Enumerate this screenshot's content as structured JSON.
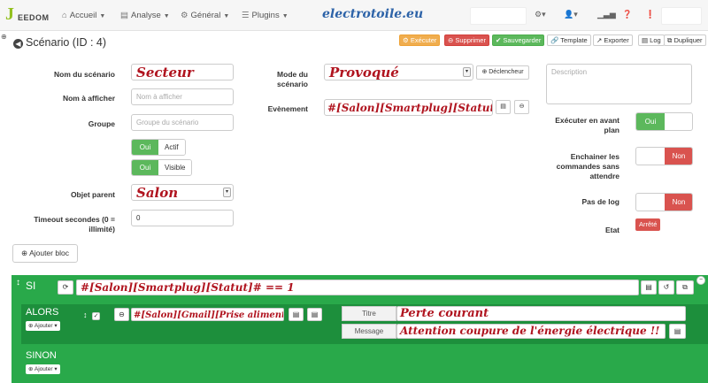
{
  "navbar": {
    "logo_text": "EEDOM",
    "menu": [
      "Accueil",
      "Analyse",
      "Général",
      "Plugins"
    ],
    "watermark": "electrotoile.eu"
  },
  "header": {
    "title": "Scénario (ID : 4)",
    "buttons": {
      "execute": "Exécuter",
      "delete": "Supprimer",
      "save": "Sauvegarder",
      "template": "Template",
      "export": "Exporter",
      "log": "Log",
      "duplicate": "Dupliquer"
    }
  },
  "form": {
    "name_label": "Nom du scénario",
    "name_value": "Secteur",
    "display_label": "Nom à afficher",
    "display_placeholder": "Nom à afficher",
    "group_label": "Groupe",
    "group_placeholder": "Groupe du scénario",
    "active_on": "Oui",
    "active_label": "Actif",
    "visible_on": "Oui",
    "visible_label": "Visible",
    "parent_label": "Objet parent",
    "parent_value": "Salon",
    "timeout_label": "Timeout secondes (0 = illimité)",
    "timeout_value": "0",
    "mode_label": "Mode du scénario",
    "mode_value": "Provoqué",
    "trigger_button": "Déclencheur",
    "event_label": "Evènement",
    "event_value": "#[Salon][Smartplug][Statut]#",
    "description_placeholder": "Description",
    "foreground_label": "Exécuter en avant plan",
    "foreground_value": "Oui",
    "chain_label": "Enchainer les commandes sans attendre",
    "chain_value": "Non",
    "nolog_label": "Pas de log",
    "nolog_value": "Non",
    "state_label": "Etat",
    "state_value": "Arrêté"
  },
  "blocks": {
    "add_block": "Ajouter bloc",
    "si_label": "SI",
    "condition": "#[Salon][Smartplug][Statut]# == 1",
    "alors_label": "ALORS",
    "add_label": "Ajouter",
    "action_cmd": "#[Salon][Gmail][Prise alimenté]#",
    "title_label": "Titre",
    "title_value": "Perte courant",
    "message_label": "Message",
    "message_value": "Attention coupure de l'énergie électrique !!",
    "sinon_label": "SINON",
    "add_label_2": "Ajouter"
  },
  "colors": {
    "green": "#5cb85c",
    "red": "#d9534f",
    "orange": "#f0ad4e",
    "panel_green": "#29a94a",
    "handwriting": "#b0141f"
  }
}
